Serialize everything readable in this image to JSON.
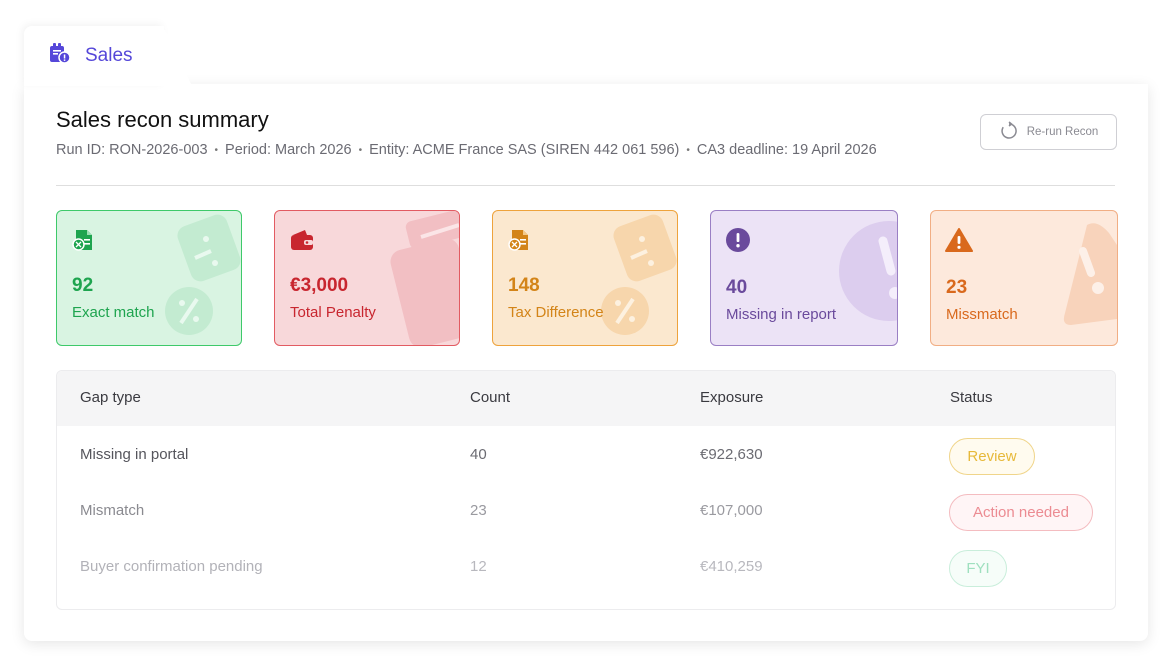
{
  "tab": {
    "label": "Sales",
    "icon": "receipt-bag-icon"
  },
  "summary": {
    "title": "Sales recon summary",
    "run_id": "Run ID: RON-2026-003",
    "period": "Period: March 2026",
    "entity": "Entity: ACME France SAS (SIREN 442 061 596)",
    "deadline": "CA3 deadline: 19 April 2026",
    "separator": "•",
    "rerun_label": "Re-run Recon"
  },
  "kpis": [
    {
      "value": "92",
      "label": "Exact match",
      "icon": "tax-document-icon",
      "color": "#1ea44f",
      "bg": "#d9f4e2",
      "border": "#3ec96a"
    },
    {
      "value": "€3,000",
      "label": "Total Penalty",
      "icon": "wallet-icon",
      "color": "#c8262f",
      "bg": "#f8d8da",
      "border": "#e25b62"
    },
    {
      "value": "148",
      "label": "Tax Difference",
      "icon": "tax-document-icon",
      "color": "#d38418",
      "bg": "#fbe8cf",
      "border": "#eea33c"
    },
    {
      "value": "40",
      "label": "Missing in report",
      "icon": "exclamation-circle-icon",
      "color": "#6a4a9c",
      "bg": "#ece3f6",
      "border": "#9a7fc4"
    },
    {
      "value": "23",
      "label": "Missmatch",
      "icon": "warning-triangle-icon",
      "color": "#d9691d",
      "bg": "#fde9dc",
      "border": "#f1ae84"
    }
  ],
  "table": {
    "headers": [
      "Gap type",
      "Count",
      "Exposure",
      "Status"
    ],
    "rows": [
      {
        "gap": "Missing in portal",
        "count": "40",
        "exposure": "€922,630",
        "status": "Review"
      },
      {
        "gap": "Mismatch",
        "count": "23",
        "exposure": "€107,000",
        "status": "Action needed"
      },
      {
        "gap": "Buyer confirmation pending",
        "count": "12",
        "exposure": "€410,259",
        "status": "FYI"
      }
    ]
  },
  "colors": {
    "accent": "#5547d9",
    "review": "#e7b93a",
    "action": "#ec8b92",
    "fyi": "#9fe0bf"
  }
}
